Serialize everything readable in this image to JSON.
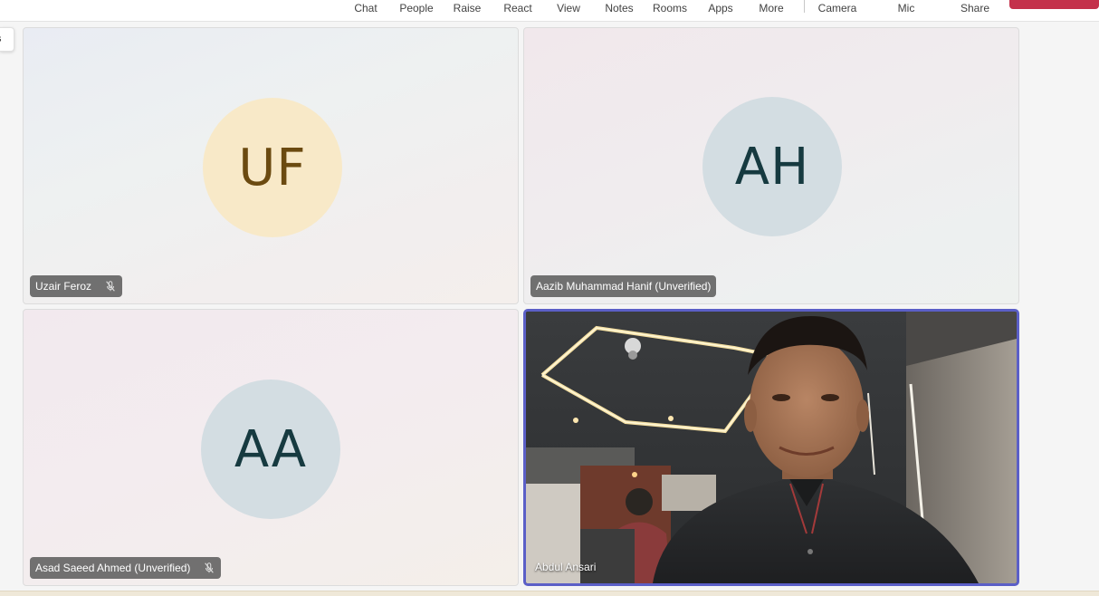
{
  "toolbar": {
    "items": [
      {
        "label": "Chat",
        "icon": "chat-icon"
      },
      {
        "label": "People",
        "icon": "people-icon"
      },
      {
        "label": "Raise",
        "icon": "raise-hand-icon"
      },
      {
        "label": "React",
        "icon": "react-icon"
      },
      {
        "label": "View",
        "icon": "view-icon"
      },
      {
        "label": "Notes",
        "icon": "notes-icon"
      },
      {
        "label": "Rooms",
        "icon": "rooms-icon"
      },
      {
        "label": "Apps",
        "icon": "apps-icon"
      },
      {
        "label": "More",
        "icon": "more-icon"
      },
      {
        "label": "Camera",
        "icon": "camera-icon"
      },
      {
        "label": "Mic",
        "icon": "mic-icon"
      },
      {
        "label": "Share",
        "icon": "share-icon"
      }
    ],
    "leave_color": "#c4314b"
  },
  "side_tab": {
    "label": "s"
  },
  "participants": [
    {
      "name": "Uzair Feroz",
      "initials": "UF",
      "muted": true,
      "avatar_bg": "#f8e9c8",
      "avatar_fg": "#6b4a10",
      "video": false
    },
    {
      "name": "Aazib Muhammad Hanif (Unverified)",
      "initials": "AH",
      "muted": false,
      "avatar_bg": "#d3dde2",
      "avatar_fg": "#163a40",
      "video": false
    },
    {
      "name": "Asad Saeed Ahmed (Unverified)",
      "initials": "AA",
      "muted": true,
      "avatar_bg": "#d3dde2",
      "avatar_fg": "#163a40",
      "video": false
    },
    {
      "name": "Abdul Ansari",
      "initials": "",
      "muted": false,
      "video": true,
      "active_speaker_color": "#5b5fc7"
    }
  ]
}
